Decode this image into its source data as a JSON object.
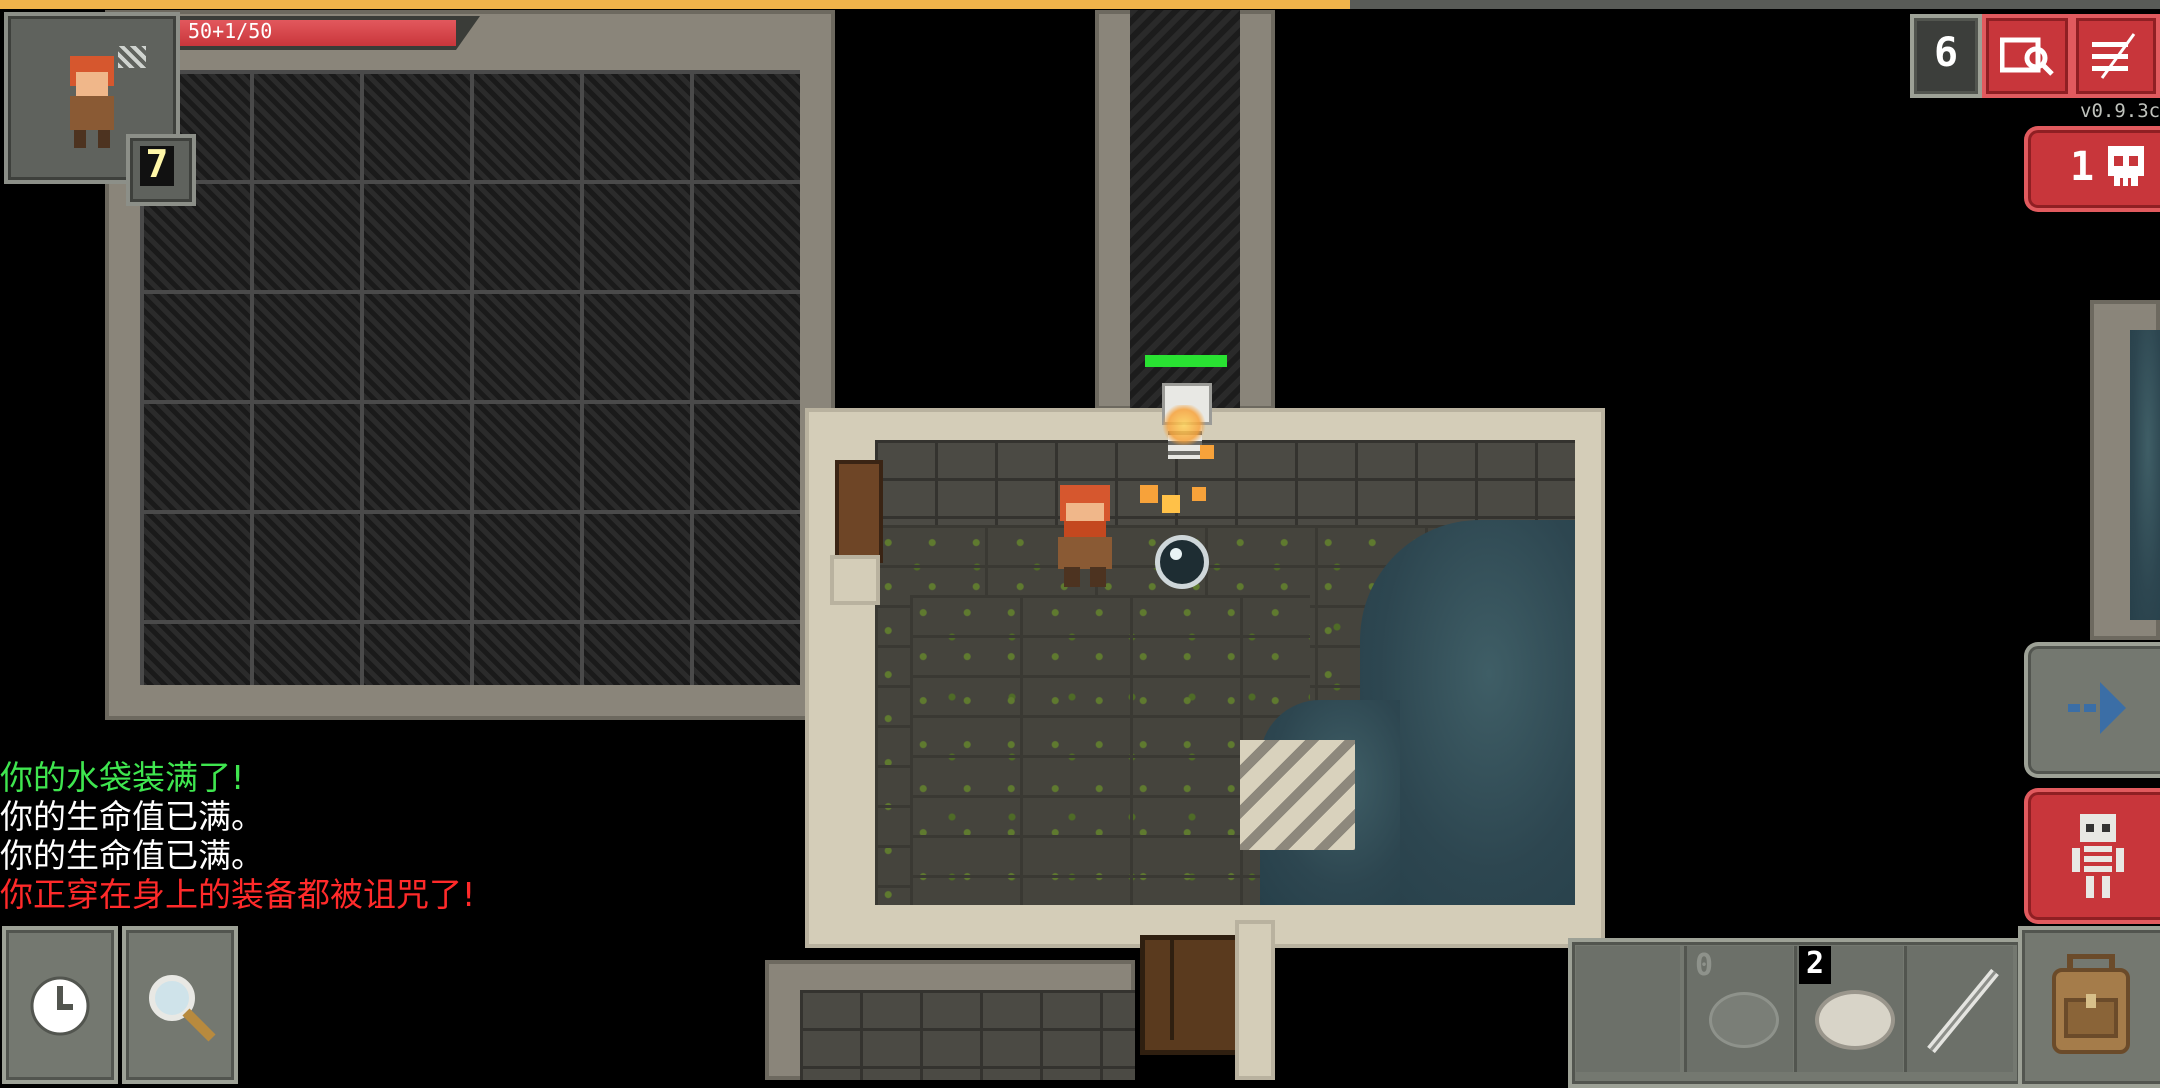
{
  "hud": {
    "hp_text": "50+1/50",
    "hero_level": "7",
    "depth": "6",
    "version": "v0.9.3c",
    "danger_count": "1"
  },
  "quickslots": {
    "slot2_count": "0",
    "slot3_count": "2"
  },
  "log": [
    {
      "text": "你的水袋装满了!",
      "color": "#3fe64f"
    },
    {
      "text": "你的生命值已满。",
      "color": "#ffffff"
    },
    {
      "text": "你的生命值已满。",
      "color": "#ffffff"
    },
    {
      "text": "你正穿在身上的装备都被诅咒了!",
      "color": "#ff2a2a"
    }
  ],
  "colors": {
    "hp_bar": "#c9363b",
    "xp_bar": "#f0b34a",
    "enemy_health": "#29e232"
  },
  "icons": {
    "wait": "clock-icon",
    "search": "magnifier-icon",
    "journal": "journal-icon",
    "menu": "menu-icon",
    "danger": "skull-icon",
    "resume": "arrow-right-icon",
    "attack": "skeleton-icon",
    "backpack": "backpack-icon"
  },
  "progress": {
    "xp_fraction": 0.625,
    "hp_fraction": 1.0,
    "enemy_hp_fraction": 1.0
  }
}
